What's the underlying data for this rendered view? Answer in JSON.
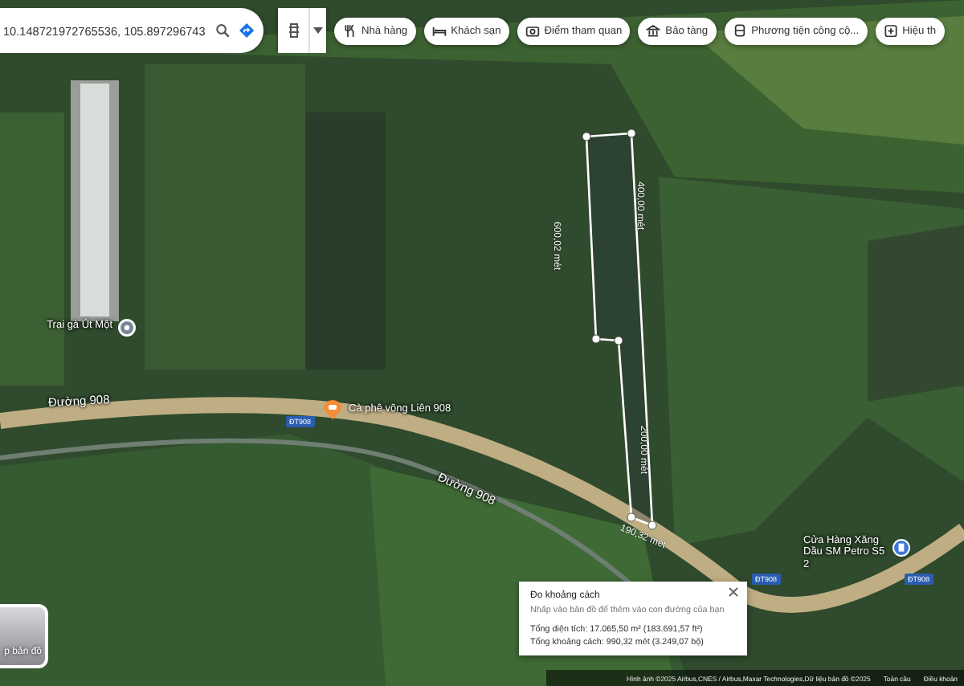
{
  "search": {
    "value": "10.148721972765536, 105.897296743"
  },
  "chips": [
    {
      "label": "Nhà hàng",
      "kind": "restaurant"
    },
    {
      "label": "Khách sạn",
      "kind": "hotel"
    },
    {
      "label": "Điểm tham quan",
      "kind": "camera"
    },
    {
      "label": "Bảo tàng",
      "kind": "museum"
    },
    {
      "label": "Phương tiện công cộ...",
      "kind": "transit"
    },
    {
      "label": "Hiệu th",
      "kind": "pharmacy"
    }
  ],
  "places": [
    {
      "label": "Trại gà Út Một",
      "kind": "pin"
    },
    {
      "label": "Cà phê võng Liên 908",
      "kind": "cafe"
    },
    {
      "label": "Cửa Hàng Xăng Dầu SM Petro S5 2",
      "kind": "gas"
    }
  ],
  "roads": [
    "Đường 908",
    "Đường 908"
  ],
  "shields": [
    "ĐT908",
    "ĐT908",
    "ĐT908"
  ],
  "measure_labels": [
    "400,00 mét",
    "600,02 mét",
    "200,00 mét",
    "190,32 mét"
  ],
  "measure_panel": {
    "title": "Đo khoảng cách",
    "hint": "Nhấp vào bản đồ để thêm vào con đường của bạn",
    "area": "Tổng diện tích: 17.065,50 m² (183.691,57 ft²)",
    "distance": "Tổng khoảng cách: 990,32 mét (3.249,07 bộ)"
  },
  "layers_button": {
    "label": "p bản đồ"
  },
  "attribution": {
    "credits": "Hình ảnh ©2025 Airbus,CNES / Airbus,Maxar Technologies,Dữ liệu bản đồ ©2025",
    "region": "Toàn cầu",
    "terms": "Điều khoản"
  }
}
